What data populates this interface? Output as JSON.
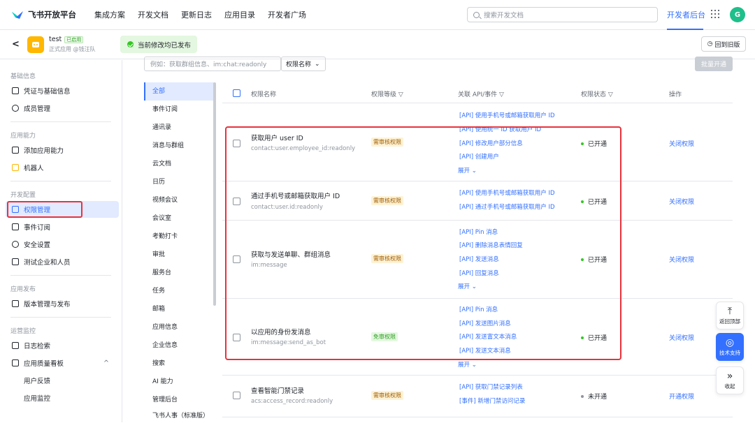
{
  "brand": {
    "name": "飞书开放平台"
  },
  "topnav": [
    "集成方案",
    "开发文档",
    "更新日志",
    "应用目录",
    "开发者广场"
  ],
  "search": {
    "placeholder": "搜索开发文档"
  },
  "dev_console": "开发者后台",
  "user_avatar": "G",
  "app": {
    "name": "test",
    "badge": "已启用",
    "subtitle": "正式应用 @钱汪队"
  },
  "publish_status": "当前修改均已发布",
  "old_version": "回到旧版",
  "sidebar": {
    "groups": [
      "基础信息",
      "应用能力",
      "开发配置",
      "应用发布",
      "运营监控"
    ],
    "items": [
      {
        "label": "凭证与基础信息",
        "icon": "credential-icon"
      },
      {
        "label": "成员管理",
        "icon": "member-icon"
      },
      {
        "label": "添加应用能力",
        "icon": "grid-icon"
      },
      {
        "label": "机器人",
        "icon": "robot-icon"
      },
      {
        "label": "权限管理",
        "icon": "lock-icon"
      },
      {
        "label": "事件订阅",
        "icon": "event-icon"
      },
      {
        "label": "安全设置",
        "icon": "shield-icon"
      },
      {
        "label": "测试企业和人员",
        "icon": "test-icon"
      },
      {
        "label": "版本管理与发布",
        "icon": "upload-icon"
      },
      {
        "label": "日志检索",
        "icon": "log-icon"
      },
      {
        "label": "应用质量看板",
        "icon": "chart-icon"
      },
      {
        "label": "用户反馈",
        "icon": ""
      },
      {
        "label": "应用监控",
        "icon": ""
      }
    ]
  },
  "filter": {
    "placeholder": "例如：获取群组信息、im:chat:readonly",
    "select": "权限名称",
    "bulk": "批量开通"
  },
  "categories": [
    "全部",
    "事件订阅",
    "通讯录",
    "消息与群组",
    "云文档",
    "日历",
    "视频会议",
    "会议室",
    "考勤打卡",
    "审批",
    "服务台",
    "任务",
    "邮箱",
    "应用信息",
    "企业信息",
    "搜索",
    "AI 能力",
    "管理后台",
    "飞书人事（标准版）"
  ],
  "table": {
    "headers": [
      "权限名称",
      "权限等级",
      "关联 API/事件",
      "权限状态",
      "操作"
    ],
    "rows": [
      {
        "name": "获取用户 user ID",
        "code": "contact:user.employee_id:readonly",
        "level": "需审核权限",
        "apis": [
          "[API] 使用手机号或邮箱获取用户 ID",
          "[API] 使用统一 ID 获取用户 ID",
          "[API] 修改用户部分信息",
          "[API] 创建用户"
        ],
        "expand": "展开",
        "status": "已开通",
        "op": "关闭权限"
      },
      {
        "name": "通过手机号或邮箱获取用户 ID",
        "code": "contact:user.id:readonly",
        "level": "需审核权限",
        "apis": [
          "[API] 使用手机号或邮箱获取用户 ID",
          "[API] 通过手机号或邮箱获取用户 ID"
        ],
        "expand": "",
        "status": "已开通",
        "op": "关闭权限"
      },
      {
        "name": "获取与发送单聊、群组消息",
        "code": "im:message",
        "level": "需审核权限",
        "apis": [
          "[API] Pin 消息",
          "[API] 删除消息表情回复",
          "[API] 发送消息",
          "[API] 回复消息"
        ],
        "expand": "展开",
        "status": "已开通",
        "op": "关闭权限"
      },
      {
        "name": "以应用的身份发消息",
        "code": "im:message:send_as_bot",
        "level": "免审权限",
        "apis": [
          "[API] Pin 消息",
          "[API] 发送图片消息",
          "[API] 发送富文本消息",
          "[API] 发送文本消息"
        ],
        "expand": "展开",
        "status": "已开通",
        "op": "关闭权限"
      },
      {
        "name": "查看智能门禁记录",
        "code": "acs:access_record:readonly",
        "level": "需审核权限",
        "apis": [
          "[API] 获取门禁记录列表",
          "[事件] 新增门禁访问记录"
        ],
        "expand": "",
        "status": "未开通",
        "op": "开通权限"
      }
    ]
  },
  "float": [
    {
      "label": "返回顶部",
      "icon": "arrow-up-icon"
    },
    {
      "label": "技术支持",
      "icon": "support-icon"
    },
    {
      "label": "收起",
      "icon": "collapse-icon"
    }
  ]
}
